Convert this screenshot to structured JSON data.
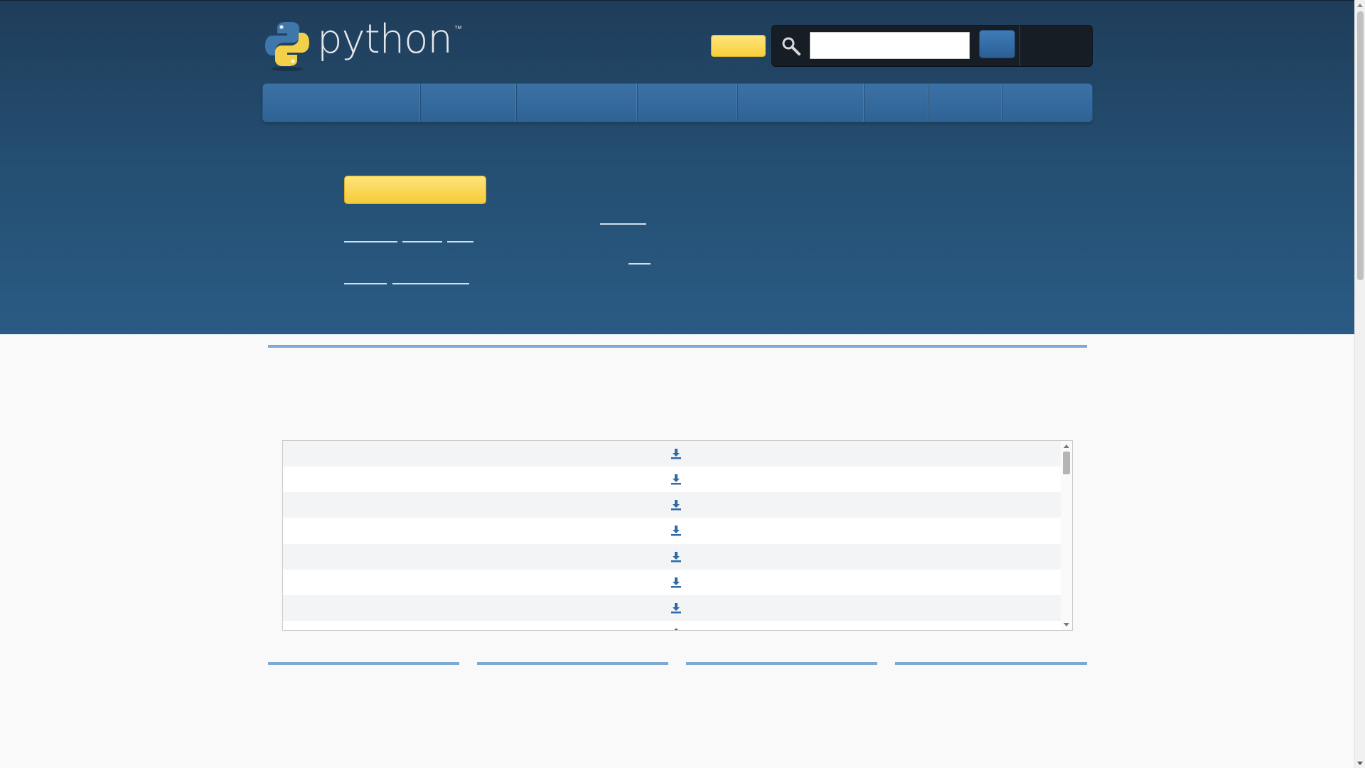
{
  "brand": {
    "wordmark": "python",
    "trademark": "™"
  },
  "colors": {
    "header_dark": "#1f3d5a",
    "header_light": "#2a5b84",
    "accent_yellow": "#f7cf3c",
    "accent_blue": "#3b72a6",
    "rule_blue": "#7ea9d0"
  },
  "search": {
    "value": "",
    "placeholder": ""
  },
  "icons": {
    "logo": "python-logo-icon",
    "search": "magnifier-icon",
    "download": "download-icon"
  },
  "nav": {
    "tab_count": 8
  },
  "downloads_list": {
    "visible_rows": 8
  }
}
